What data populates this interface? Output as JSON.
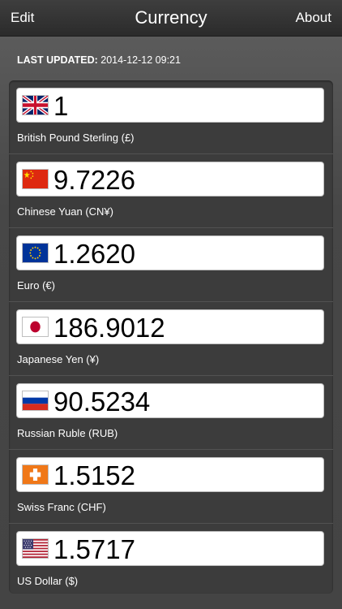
{
  "nav": {
    "edit_label": "Edit",
    "title": "Currency",
    "about_label": "About"
  },
  "updated": {
    "label": "LAST UPDATED:",
    "value": "2014-12-12 09:21"
  },
  "currencies": [
    {
      "flag_icon": "uk-flag-icon",
      "amount": "1",
      "name": "British Pound Sterling (£)"
    },
    {
      "flag_icon": "china-flag-icon",
      "amount": "9.7226",
      "name": "Chinese Yuan (CN¥)"
    },
    {
      "flag_icon": "eu-flag-icon",
      "amount": "1.2620",
      "name": "Euro (€)"
    },
    {
      "flag_icon": "japan-flag-icon",
      "amount": "186.9012",
      "name": "Japanese Yen (¥)"
    },
    {
      "flag_icon": "russia-flag-icon",
      "amount": "90.5234",
      "name": "Russian Ruble (RUB)"
    },
    {
      "flag_icon": "switzerland-flag-icon",
      "amount": "1.5152",
      "name": "Swiss Franc (CHF)"
    },
    {
      "flag_icon": "usa-flag-icon",
      "amount": "1.5717",
      "name": "US Dollar ($)"
    }
  ],
  "colors": {
    "navbar": "#2f2f2f",
    "background": "#4a4a4a",
    "panel": "#3c3c3c",
    "text": "#ffffff"
  }
}
